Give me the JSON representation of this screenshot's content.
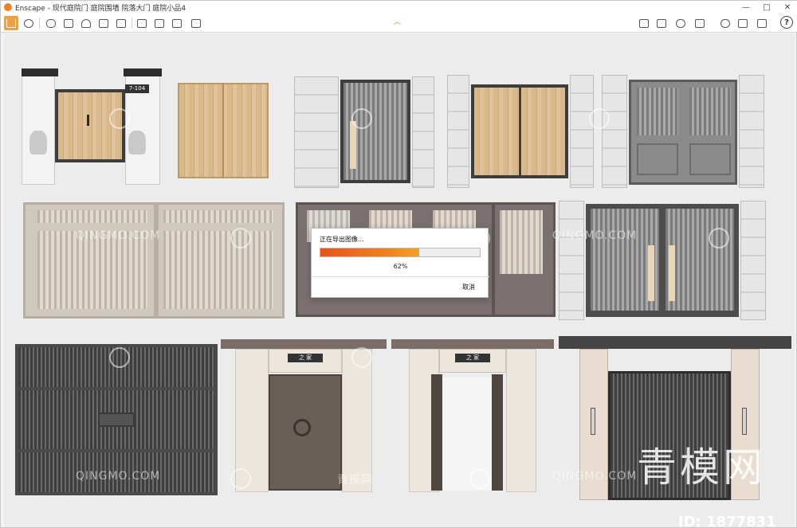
{
  "window": {
    "title": "Enscape - 现代庭院门 庭院围墙 院落大门 庭院小品4",
    "controls": {
      "minimize": "—",
      "maximize": "□",
      "close": "✕"
    }
  },
  "toolbar": {
    "left_icons": [
      "home-icon",
      "walk-icon",
      "binoculars-icon",
      "film-icon",
      "lightbulb-icon",
      "asset-icon",
      "screenshot-icon",
      "batch-icon",
      "export-icon",
      "settings-icon"
    ],
    "right_icons": [
      "map-icon",
      "panorama-icon",
      "vr-icon",
      "material-icon",
      "cloud-icon",
      "windows-icon"
    ],
    "help_label": "?"
  },
  "dialog": {
    "title": "正在导出图像...",
    "progress": 0.62,
    "percent_label": "62%",
    "cancel_label": "取消"
  },
  "scene": {
    "door_plate": "7-104",
    "sign_left": "之 家",
    "sign_right": "之 家",
    "watermark_text": "QINGMO.COM",
    "watermark_cn": "青模网",
    "watermark_big": "青模网",
    "watermark_id": "ID: 1877831"
  },
  "colors": {
    "accent": "#f08020",
    "progress_start": "#e8541a",
    "progress_end": "#f5a020"
  }
}
